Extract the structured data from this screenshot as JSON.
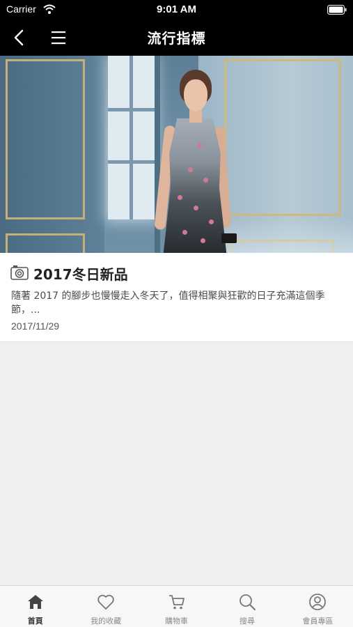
{
  "status_bar": {
    "carrier": "Carrier",
    "time": "9:01 AM"
  },
  "nav": {
    "title": "流行指標"
  },
  "article": {
    "title": "2017冬日新品",
    "excerpt": "隨著 2017 的腳步也慢慢走入冬天了，值得相聚與狂歡的日子充滿這個季節，...",
    "date": "2017/11/29"
  },
  "tabs": [
    {
      "label": "首頁",
      "icon": "home-icon",
      "active": true
    },
    {
      "label": "我的收藏",
      "icon": "heart-icon",
      "active": false
    },
    {
      "label": "購物車",
      "icon": "cart-icon",
      "active": false
    },
    {
      "label": "搜尋",
      "icon": "search-icon",
      "active": false
    },
    {
      "label": "會員專區",
      "icon": "user-icon",
      "active": false
    }
  ],
  "colors": {
    "nav_bg": "#000000",
    "tab_active": "#333333",
    "tab_inactive": "#8a8a8a"
  }
}
